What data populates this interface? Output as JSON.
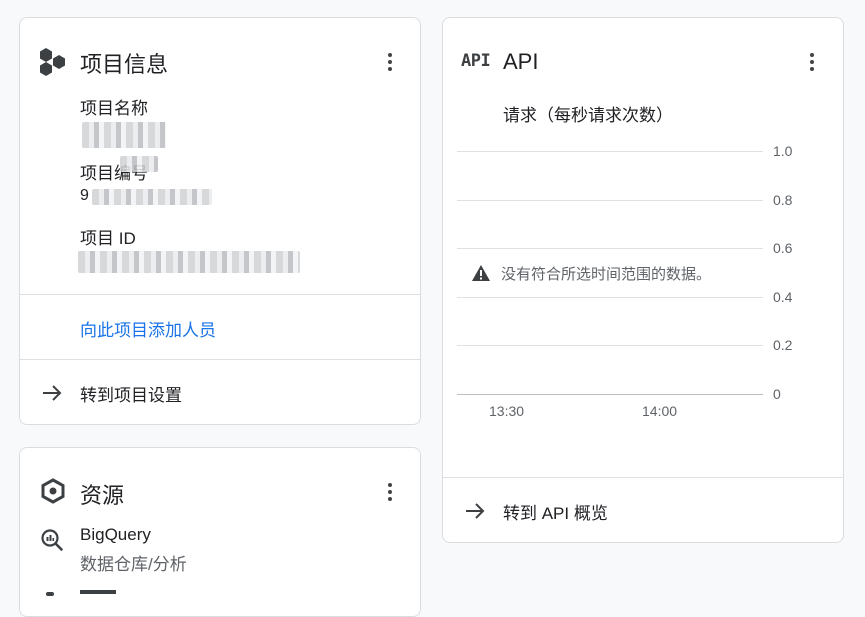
{
  "project_card": {
    "title": "项目信息",
    "icon": "hexagon-cluster-icon",
    "fields": [
      {
        "label": "项目名称",
        "value": ""
      },
      {
        "label": "项目编号",
        "value": "9"
      },
      {
        "label": "项目 ID",
        "value": ""
      }
    ],
    "add_people_link": "向此项目添加人员",
    "goto_settings": "转到项目设置"
  },
  "resources_card": {
    "title": "资源",
    "icon": "hexagon-gear-icon",
    "items": [
      {
        "name": "BigQuery",
        "description": "数据仓库/分析",
        "icon": "bigquery-icon"
      }
    ]
  },
  "api_card": {
    "badge": "API",
    "title": "API",
    "subtitle": "请求（每秒请求次数）",
    "no_data_message": "没有符合所选时间范围的数据。",
    "goto_overview": "转到 API 概览"
  },
  "chart_data": {
    "type": "line",
    "title": "请求（每秒请求次数）",
    "x": [
      "13:30",
      "14:00"
    ],
    "series": [],
    "ylim": [
      0,
      1.0
    ],
    "yticks": [
      "1.0",
      "0.8",
      "0.6",
      "0.4",
      "0.2",
      "0"
    ],
    "grid": true
  },
  "colors": {
    "link": "#1a73e8",
    "text": "#202124",
    "muted": "#5f6368",
    "border": "#dadce0"
  }
}
